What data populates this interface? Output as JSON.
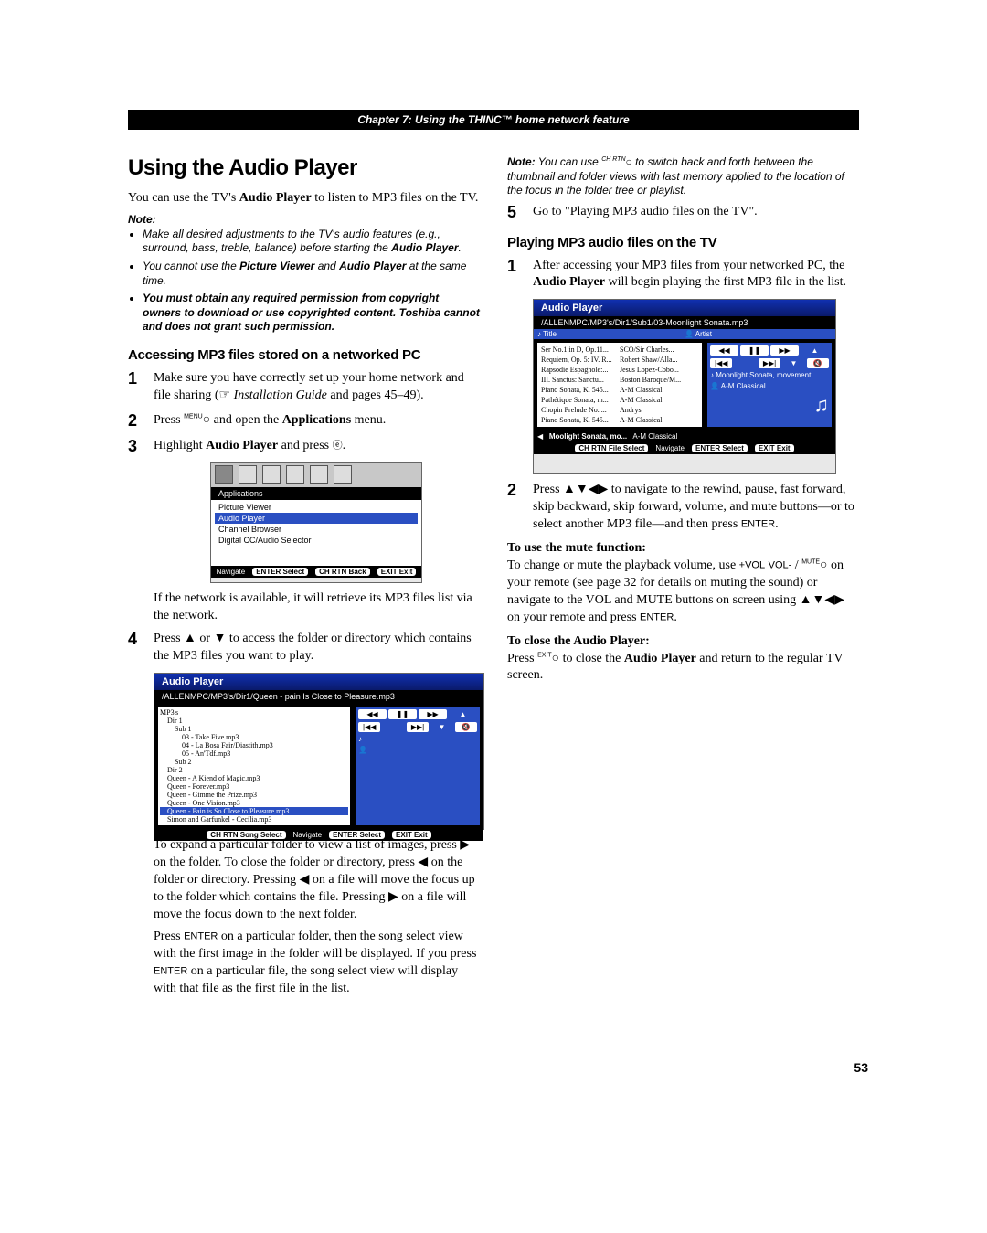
{
  "chapter_bar": "Chapter 7: Using the THINC™ home network feature",
  "h1": "Using the Audio Player",
  "intro": "You can use the TV's <b>Audio Player</b> to listen to MP3 files on the TV.",
  "note_label": "Note:",
  "notes": [
    "Make all desired adjustments to the TV's audio features (e.g., surround, bass, treble, balance) before starting the <b>Audio Player</b>.",
    "You cannot use the <b>Picture Viewer</b> and <b>Audio Player</b> at the same time.",
    "<b>You must obtain any required permission from copyright owners to download or use copyrighted content. Toshiba cannot and does not grant such permission.</b>"
  ],
  "h2_a": "Accessing MP3 files stored on a networked PC",
  "steps_a": {
    "1": "Make sure you have correctly set up your home network and file sharing (☞ <i>Installation Guide</i> and pages 45–49).",
    "2_pre": "Press ",
    "2_btn_sup": "MENU",
    "2_btn_glyph": "○",
    "2_post": " and open the <b>Applications</b> menu.",
    "3_pre": "Highlight <b>Audio Player</b> and press ",
    "3_btn": "ENTER",
    "3_post": "."
  },
  "fig1": {
    "title": "Applications",
    "rows": [
      "Picture Viewer",
      "Audio Player",
      "Channel Browser",
      "Digital CC/Audio Selector"
    ],
    "bottom": [
      "Navigate",
      "ENTER Select",
      "CH RTN Back",
      "EXIT Exit"
    ]
  },
  "after_fig1": "If the network is available, it will retrieve its MP3 files list via the network.",
  "step4": "Press ▲ or ▼ to access the folder or directory which contains the MP3 files you want to play.",
  "fig2": {
    "title": "Audio Player",
    "path": "/ALLENMPC/MP3's/Dir1/Queen - pain Is Close to Pleasure.mp3",
    "tree": [
      "MP3's",
      "  Dir 1",
      "    Sub 1",
      "      03 - Take Five.mp3",
      "      04 - La Bosa Fair/Diastith.mp3",
      "      05 - An'Tdf.mp3",
      "    Sub 2",
      "  Dir 2",
      "  Queen - A Kiend of Magic.mp3",
      "  Queen - Forever.mp3",
      "  Queen - Gimme the Prize.mp3",
      "  Queen - One Vision.mp3",
      "  Queen - Pain is So Close to Pleasure.mp3",
      "  Simon and Garfunkel - Cecilia.mp3"
    ],
    "bottom": [
      "CH RTN Song Select",
      "Navigate",
      "ENTER Select",
      "EXIT Exit"
    ]
  },
  "after_fig2_p1": "To expand a particular folder to view a list of images, press ▶ on the folder. To close the folder or directory, press ◀ on the folder or directory. Pressing ◀ on a file will move the focus up to the folder which contains the file. Pressing ▶ on a file will move the focus down to the next folder.",
  "after_fig2_p2": "Press <span class='glyph'>ENTER</span> on a particular folder, then the song select view with the first image in the folder will be displayed. If you press <span class='glyph'>ENTER</span> on a particular file, the song select view will display with that file as the first file in the list.",
  "right_note": "<b>Note:</b> You can use <span class='tiny-sup'>CH RTN</span>○ to switch back and forth between the thumbnail and folder views with last memory applied to the location of the focus in the folder tree or playlist.",
  "step_a5": "Go to \"Playing MP3 audio files on the TV\".",
  "h2_b": "Playing MP3 audio files on the TV",
  "step_b1": "After accessing your MP3 files from your networked PC, the <b>Audio Player</b> will begin playing the first MP3 file in the list.",
  "fig3": {
    "title": "Audio Player",
    "path": "/ALLENMPC/MP3's/Dir1/Sub1/03-Moonlight Sonata.mp3",
    "cols": [
      "Title",
      "Artist"
    ],
    "rows": [
      [
        "Ser No.1 in D, Op.11...",
        "SCO/Sir Charles..."
      ],
      [
        "Requiem, Op. 5: IV. R...",
        "Robert Shaw/Alla..."
      ],
      [
        "Rapsodie Espagnole:...",
        "Jesus Lopez-Cobo..."
      ],
      [
        "III. Sanctus: Sanctu...",
        "Boston Baroque/M..."
      ],
      [
        "Piano Sonata, K. 545...",
        "A-M Classical"
      ],
      [
        "Pathétique Sonata, m...",
        "A-M Classical"
      ],
      [
        "Chopin Prelude No. ...",
        "Andrys"
      ],
      [
        "Piano Sonata, K. 545...",
        "A-M Classical"
      ]
    ],
    "highlight": [
      "Moolight Sonata, mo...",
      "A-M Classical"
    ],
    "panel": [
      "Moonlight Sonata, movement",
      "A-M Classical"
    ],
    "bottom": [
      "CH RTN File Select",
      "Navigate",
      "ENTER Select",
      "EXIT Exit"
    ]
  },
  "step_b2": "Press ▲▼◀▶ to navigate to the rewind, pause, fast forward, skip backward, skip forward, volume, and mute buttons—or to select another MP3 file—and then press <span class='glyph'>ENTER</span>.",
  "mute_h": "To use the mute function:",
  "mute_p": "To change or mute the playback volume, use <span class='glyph'>+VOL</span> <span class='glyph'>VOL-</span> / <span class='tiny-sup'>MUTE</span>○ on your remote (see page 32 for details on muting the sound) or navigate to the VOL and MUTE buttons on screen using ▲▼◀▶ on your remote and press <span class='glyph'>ENTER</span>.",
  "close_h": "To close the Audio Player:",
  "close_p": "Press <span class='tiny-sup'>EXIT</span>○ to close the <b>Audio Player</b> and return to the regular TV screen.",
  "pagenum": "53"
}
